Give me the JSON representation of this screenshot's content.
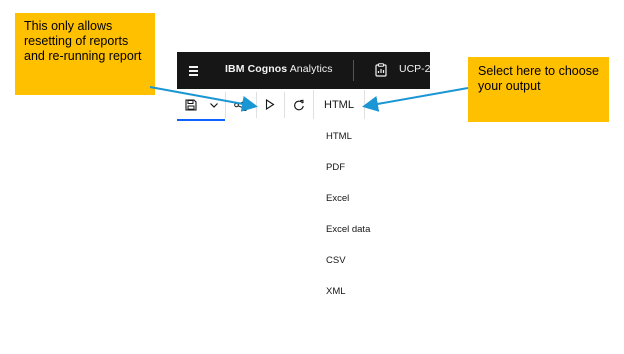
{
  "topbar": {
    "app_name_bold": "IBM Cognos",
    "app_name_rest": " Analytics",
    "report_name": "UCP-2"
  },
  "toolbar": {
    "icons": [
      "save-icon",
      "chevron-down-icon",
      "share-icon",
      "run-icon",
      "refresh-icon"
    ],
    "output_format_selected": "HTML"
  },
  "output_menu": {
    "options": [
      "HTML",
      "PDF",
      "Excel",
      "Excel data",
      "CSV",
      "XML"
    ]
  },
  "annotations": {
    "left_callout": "This only allows resetting of reports and re-running report",
    "right_callout": "Select here to choose your output",
    "callout_color": "#ffc000",
    "arrow_color": "#1a96d4"
  },
  "colors": {
    "topbar_bg": "#161616",
    "accent": "#0f62fe"
  }
}
